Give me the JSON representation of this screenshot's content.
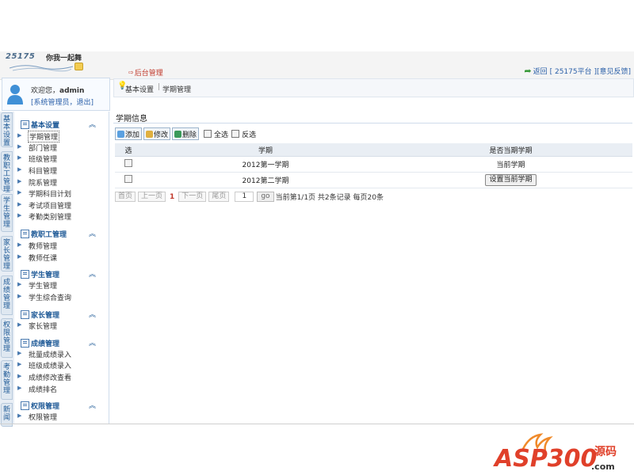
{
  "header": {
    "brand": "25175",
    "slogan": "你我一起舞",
    "breadcrumb_root": "后台管理",
    "back_link": "返回",
    "platform_link": "[ 25175平台 ]",
    "feedback_link": "[意见反馈]"
  },
  "user": {
    "welcome": "欢迎您，",
    "name": "admin",
    "role_link": "[系统管理员，",
    "logout_link": "退出]"
  },
  "vertical_tabs": [
    "基本设置",
    "教职工管理",
    "学生管理",
    "家长管理",
    "成绩管理",
    "权限管理",
    "考勤管理",
    "新闻"
  ],
  "menu": {
    "groups": [
      {
        "label": "基本设置",
        "items": [
          "学期管理",
          "部门管理",
          "班级管理",
          "科目管理",
          "院系管理",
          "学期科目计划",
          "考试项目管理",
          "考勤类别管理"
        ]
      },
      {
        "label": "教职工管理",
        "items": [
          "教师管理",
          "教师任课"
        ]
      },
      {
        "label": "学生管理",
        "items": [
          "学生管理",
          "学生综合查询"
        ]
      },
      {
        "label": "家长管理",
        "items": [
          "家长管理"
        ]
      },
      {
        "label": "成绩管理",
        "items": [
          "批量成绩录入",
          "班级成绩录入",
          "成绩修改查看",
          "成绩排名"
        ]
      },
      {
        "label": "权限管理",
        "items": [
          "权限管理"
        ]
      }
    ],
    "fold_icon": "double-chevron-up"
  },
  "breadcrumb": {
    "level1": "基本设置",
    "level2": "学期管理"
  },
  "section_title": "学期信息",
  "toolbar": {
    "add": "添加",
    "edit": "修改",
    "delete": "删除",
    "select_all": "全选",
    "invert": "反选"
  },
  "table": {
    "headers": [
      "选",
      "学期",
      "是否当期学期"
    ],
    "rows": [
      {
        "term": "2012第一学期",
        "current": "当前学期"
      },
      {
        "term": "2012第二学期",
        "current_button": "设置当前学期"
      }
    ]
  },
  "pager": {
    "first": "首页",
    "prev": "上一页",
    "current": "1",
    "next": "下一页",
    "last": "尾页",
    "input": "1",
    "go": "go",
    "summary": "当前第1/1页 共2条记录 每页20条"
  },
  "watermark": {
    "text": "ASP300",
    "suffix": "源码",
    "domain": ".com"
  },
  "colors": {
    "accent": "#1f5a97",
    "link": "#2a5fa8",
    "red": "#c0392b",
    "watermark": "#e0402a"
  }
}
